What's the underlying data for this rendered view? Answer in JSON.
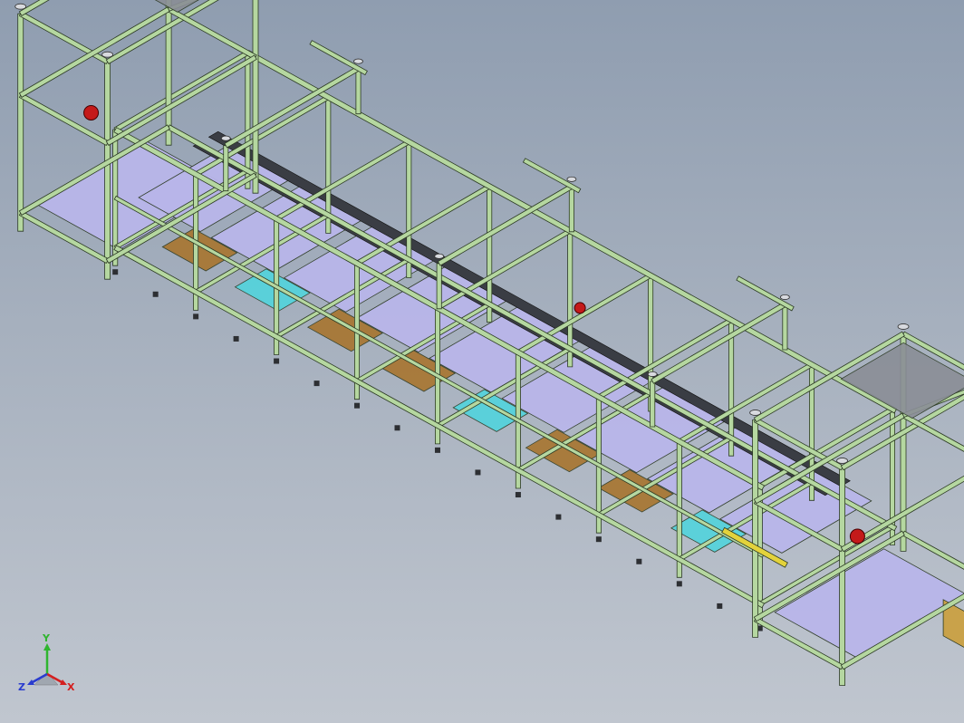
{
  "viewport": {
    "background_top": "#8f9db0",
    "background_bottom": "#c0c6cf"
  },
  "model": {
    "frame_color": "#b5d7a0",
    "frame_edge_color": "#2c3a24",
    "plate_color": "#b9b6ea",
    "accent_red": "#c41a1a",
    "accent_cyan": "#52d4dd",
    "accent_yellow": "#e3d23c",
    "accent_brown": "#a8752f",
    "base_color": "#c9a24a",
    "rail_color": "#3a3d44"
  },
  "triad": {
    "x_label": "X",
    "y_label": "Y",
    "z_label": "Z",
    "x_color": "#d41f1f",
    "y_color": "#2fb52f",
    "z_color": "#2a3ccf"
  }
}
